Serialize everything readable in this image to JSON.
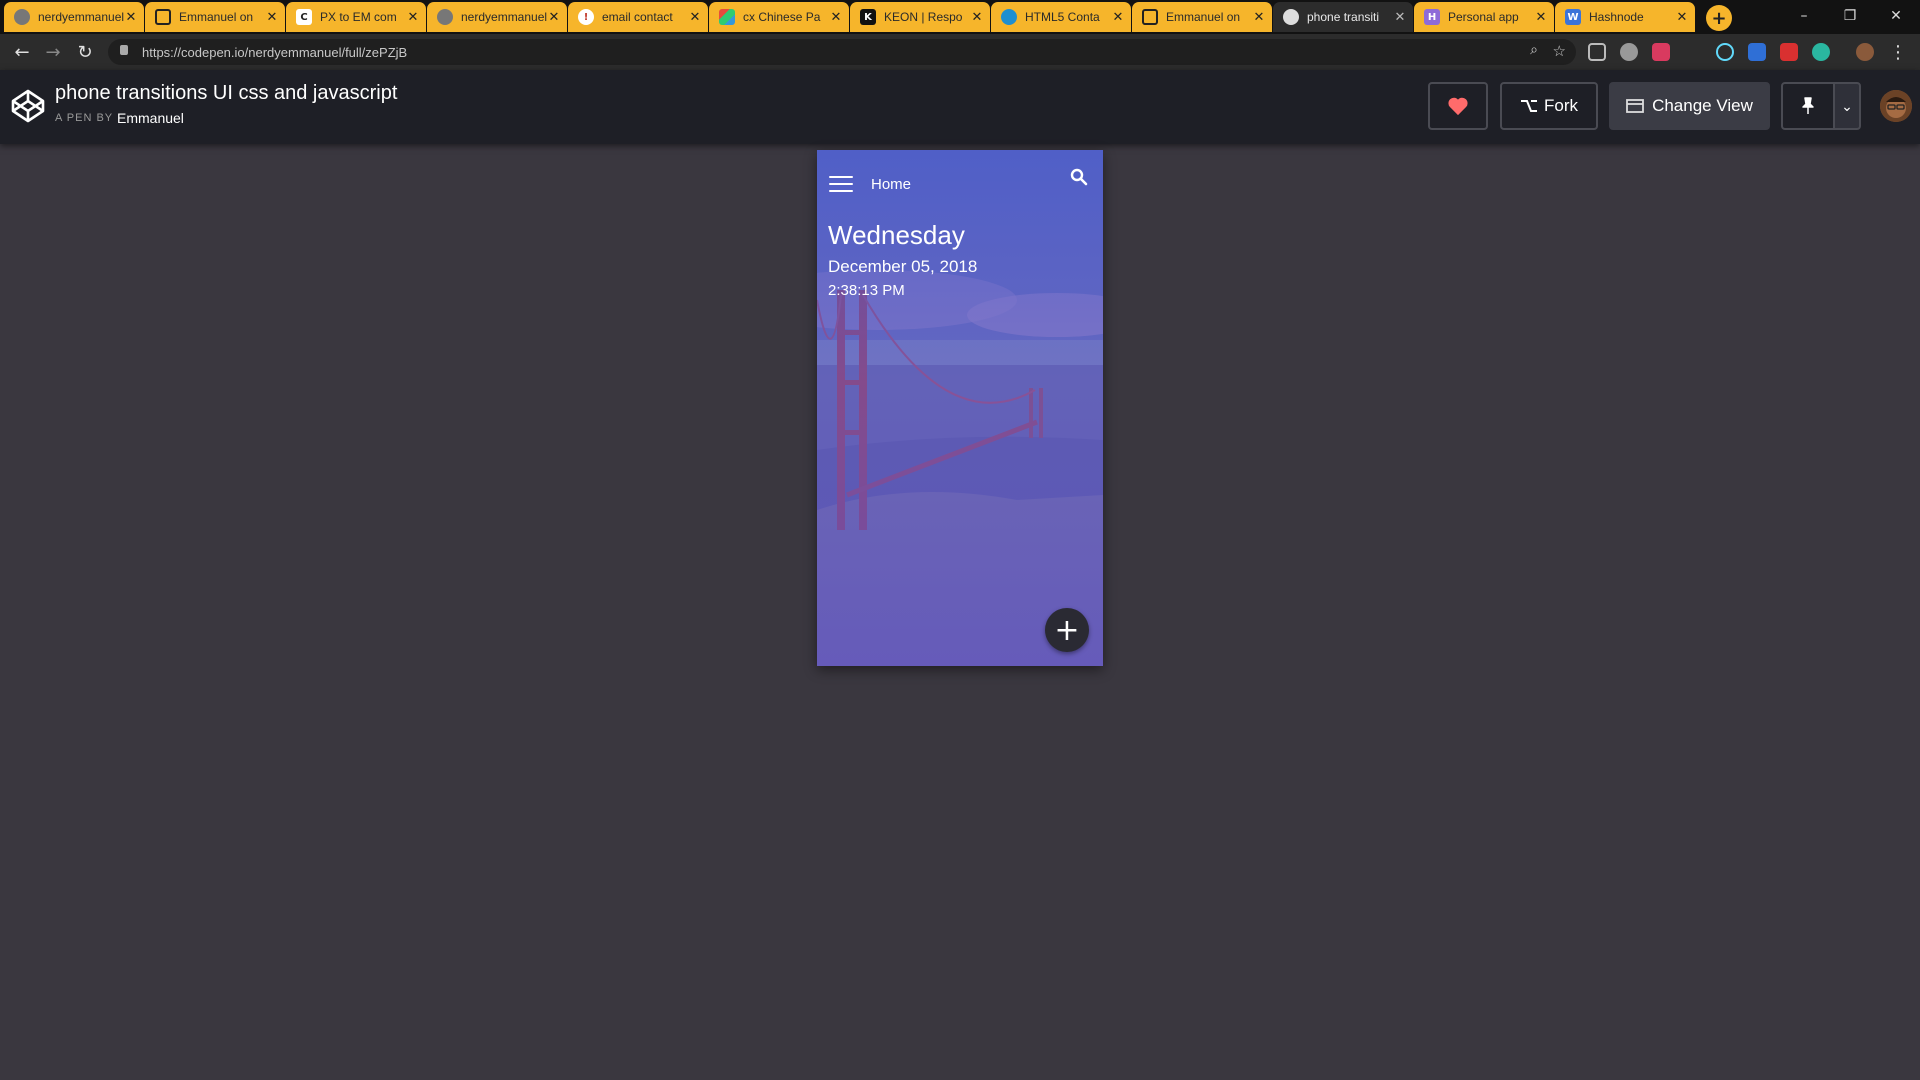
{
  "browser": {
    "tabs": [
      {
        "title": "nerdyemmanuel",
        "active": false,
        "favicon": "globe-icon"
      },
      {
        "title": "Emmanuel on",
        "active": false,
        "favicon": "codepen-icon"
      },
      {
        "title": "PX to EM com",
        "active": false,
        "favicon": "c-icon"
      },
      {
        "title": "nerdyemmanuel",
        "active": false,
        "favicon": "globe-icon"
      },
      {
        "title": "email contact",
        "active": false,
        "favicon": "info-icon"
      },
      {
        "title": "cx Chinese Pa",
        "active": false,
        "favicon": "colorful-icon"
      },
      {
        "title": "KEON | Respo",
        "active": false,
        "favicon": "k-icon"
      },
      {
        "title": "HTML5 Conta",
        "active": false,
        "favicon": "dot-icon"
      },
      {
        "title": "Emmanuel on",
        "active": false,
        "favicon": "codepen-icon"
      },
      {
        "title": "phone transiti",
        "active": true,
        "favicon": "globe-icon"
      },
      {
        "title": "Personal app",
        "active": false,
        "favicon": "h-icon"
      },
      {
        "title": "Hashnode",
        "active": false,
        "favicon": "w-icon"
      }
    ],
    "url": "https://codepen.io/nerdyemmanuel/full/zePZjB"
  },
  "codepen": {
    "title": "phone transitions UI css and javascript",
    "by_label": "A PEN BY",
    "author": "Emmanuel",
    "fork_label": "Fork",
    "change_view_label": "Change View"
  },
  "phone": {
    "nav_title": "Home",
    "day": "Wednesday",
    "date": "December 05, 2018",
    "time": "2:38:13 PM"
  },
  "colors": {
    "tab_yellow": "#f6b52b",
    "page_bg": "#3a373f",
    "header_bg": "#1e1f26",
    "heart": "#ff6b6b",
    "phone_tint": "#4d57c8"
  }
}
